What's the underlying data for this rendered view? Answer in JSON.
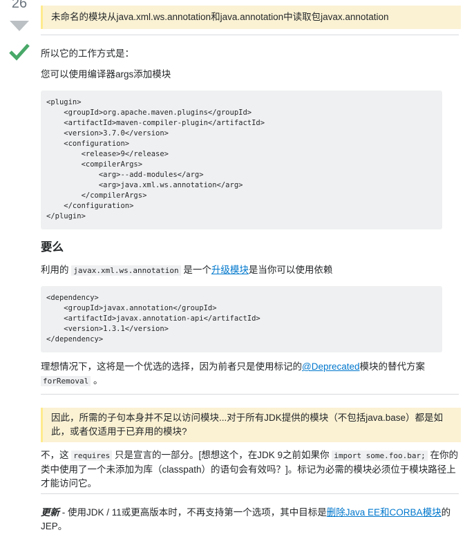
{
  "vote": {
    "count": "26"
  },
  "answer": {
    "note1": "未命名的模块从java.xml.ws.annotation和java.annotation中读取包javax.annotation",
    "p1": "所以它的工作方式是：",
    "p2": "您可以使用编译器args添加模块",
    "code1": "<plugin>\n    <groupId>org.apache.maven.plugins</groupId>\n    <artifactId>maven-compiler-plugin</artifactId>\n    <version>3.7.0</version>\n    <configuration>\n        <release>9</release>\n        <compilerArgs>\n            <arg>--add-modules</arg>\n            <arg>java.xml.ws.annotation</arg>\n        </compilerArgs>\n    </configuration>\n</plugin>",
    "heading": "要么",
    "p3": {
      "pre": "利用的 ",
      "code": "javax.xml.ws.annotation",
      "mid": " 是一个",
      "link": "升级模块",
      "post": "是当你可以使用依赖"
    },
    "code2": "<dependency>\n    <groupId>javax.annotation</groupId>\n    <artifactId>javax.annotation-api</artifactId>\n    <version>1.3.1</version>\n</dependency>",
    "p4": {
      "pre": "理想情况下，这将是一个优选的选择，因为前者只是使用标记的",
      "link": "@Deprecated",
      "mid": "模块的替代方案",
      "code": "forRemoval",
      "post": " 。"
    },
    "note2": "因此，所需的子句本身并不足以访问模块...对于所有JDK提供的模块（不包括java.base）都是如此，或者仅适用于已弃用的模块?",
    "p5": {
      "pre": "不，这 ",
      "code1": "requires",
      "mid1": " 只是宣言的一部分。[想想这个，在JDK 9之前如果你 ",
      "code2": "import some.foo.bar;",
      "post": " 在你的类中使用了一个未添加为库（classpath）的语句会有效吗？]。标记为必需的模块必须位于模块路径上才能访问它。"
    },
    "p6": {
      "em": "更新",
      "pre": " - 使用JDK / 11或更高版本时，不再支持第一个选项，其中目标是",
      "link": "删除Java EE和CORBA模块",
      "post": "的JEP。"
    }
  },
  "colors": {
    "note_bg": "#fbf2d4",
    "accepted_green": "#48a868",
    "link": "#0077cc",
    "code_bg": "#eff0f1"
  }
}
